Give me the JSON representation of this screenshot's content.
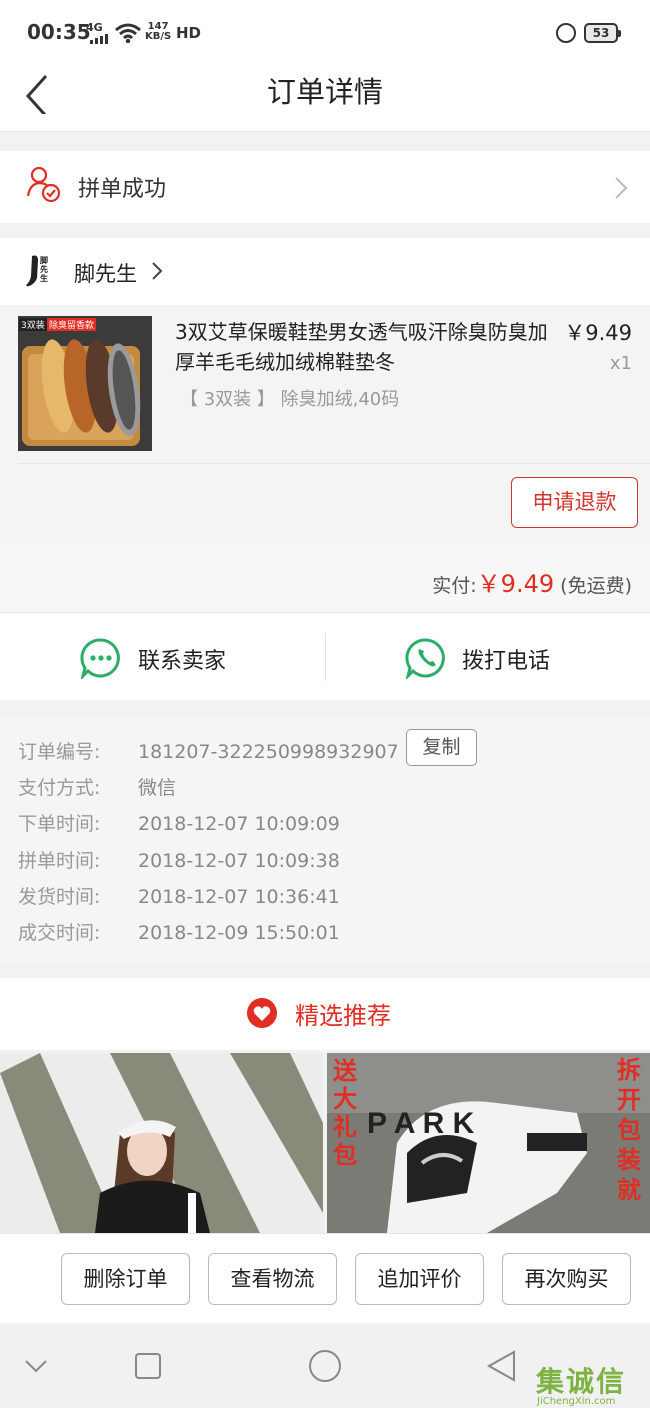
{
  "status_bar": {
    "time": "00:35",
    "network": "4G",
    "speed_value": "147",
    "speed_unit": "KB/S",
    "hd": "HD",
    "battery": "53"
  },
  "header": {
    "title": "订单详情"
  },
  "pin_status": {
    "label": "拼单成功"
  },
  "shop": {
    "name": "脚先生",
    "logo_text": "脚先生"
  },
  "product": {
    "title": "3双艾草保暖鞋垫男女透气吸汗除臭防臭加厚羊毛毛绒加绒棉鞋垫冬",
    "price": "￥9.49",
    "quantity": "x1",
    "spec": "【 3双装 】 除臭加绒,40码",
    "image_badge_1": "3双装",
    "image_badge_2": "除臭留香款",
    "refund_button": "申请退款"
  },
  "payment": {
    "label": "实付:",
    "amount": "￥9.49",
    "shipping": "(免运费)"
  },
  "contact": {
    "seller_label": "联系卖家",
    "call_label": "拨打电话"
  },
  "order_info": {
    "copy_button": "复制",
    "rows": [
      {
        "key": "订单编号:",
        "value": "181207-322250998932907"
      },
      {
        "key": "支付方式:",
        "value": "微信"
      },
      {
        "key": "下单时间:",
        "value": "2018-12-07 10:09:09"
      },
      {
        "key": "拼单时间:",
        "value": "2018-12-07 10:09:38"
      },
      {
        "key": "发货时间:",
        "value": "2018-12-07 10:36:41"
      },
      {
        "key": "成交时间:",
        "value": "2018-12-09 15:50:01"
      }
    ]
  },
  "recommend": {
    "title": "精选推荐",
    "tile_right_left_text": "送大礼包",
    "tile_right_right_text": "拆开包装就"
  },
  "bottom_buttons": {
    "delete": "删除订单",
    "logistics": "查看物流",
    "review": "追加评价",
    "rebuy": "再次购买"
  },
  "watermark": {
    "text": "集诚信",
    "url": "JiChengXin.com"
  },
  "colors": {
    "accent_red": "#e02e24",
    "button_red": "#d1352b",
    "wechat_green": "#2aae67"
  }
}
